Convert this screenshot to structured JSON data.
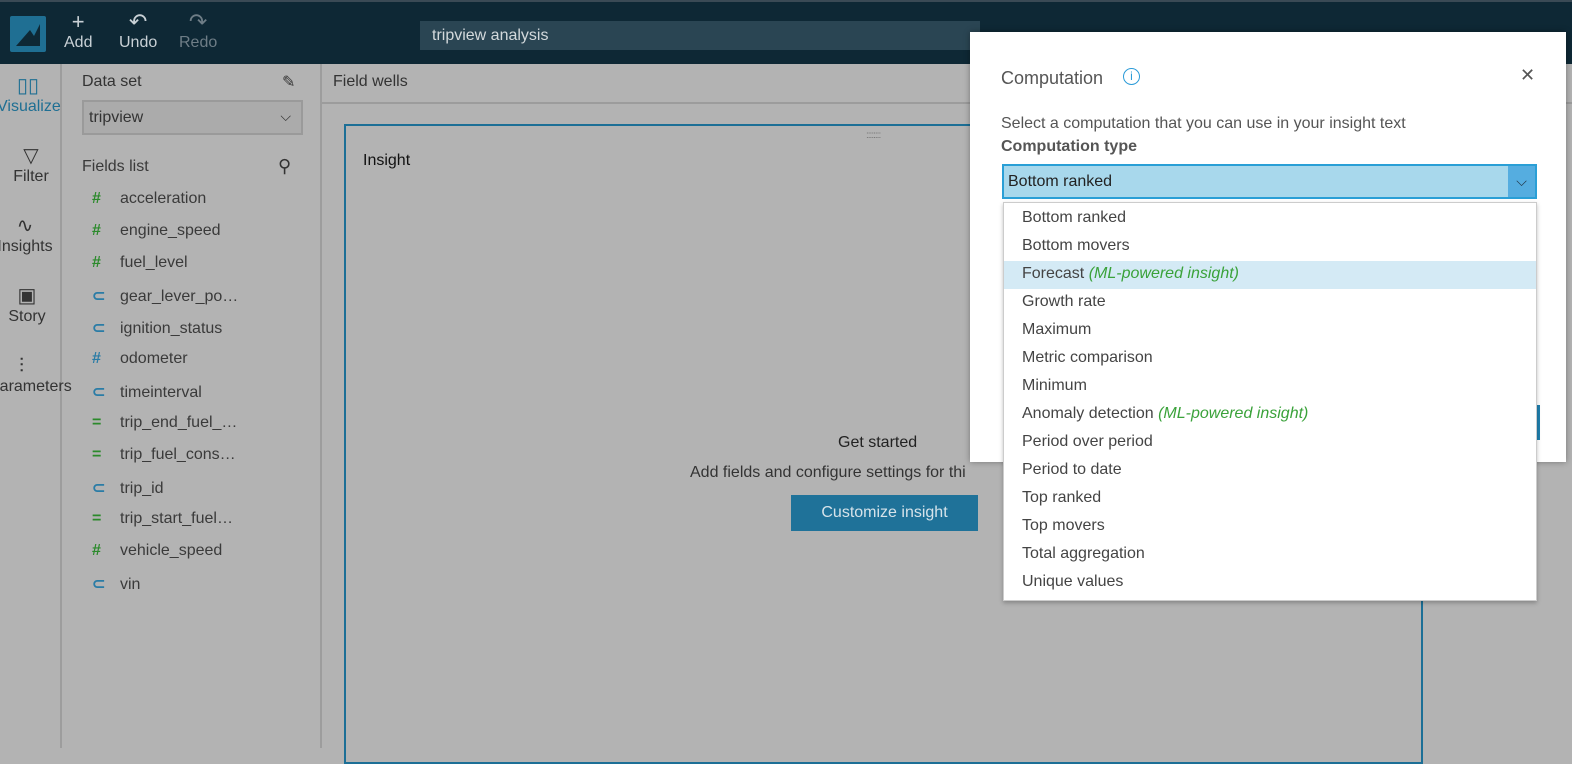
{
  "toolbar": {
    "add": "Add",
    "undo": "Undo",
    "redo": "Redo",
    "analysis_title": "tripview analysis"
  },
  "rail": [
    {
      "label": "Visualize",
      "icon": "bar-chart-icon",
      "active": true
    },
    {
      "label": "Filter",
      "icon": "funnel-icon"
    },
    {
      "label": "Insights",
      "icon": "line-chart-icon"
    },
    {
      "label": "Story",
      "icon": "story-icon"
    },
    {
      "label": "Parameters",
      "icon": "sliders-icon"
    }
  ],
  "dataset": {
    "label": "Data set",
    "value": "tripview",
    "fields_label": "Fields list"
  },
  "fields": [
    {
      "name": "acceleration",
      "type": "measure"
    },
    {
      "name": "engine_speed",
      "type": "measure"
    },
    {
      "name": "fuel_level",
      "type": "measure"
    },
    {
      "name": "gear_lever_po…",
      "type": "dimension"
    },
    {
      "name": "ignition_status",
      "type": "dimension"
    },
    {
      "name": "odometer",
      "type": "dimension-number"
    },
    {
      "name": "timeinterval",
      "type": "dimension"
    },
    {
      "name": "trip_end_fuel_…",
      "type": "calculated"
    },
    {
      "name": "trip_fuel_cons…",
      "type": "calculated"
    },
    {
      "name": "trip_id",
      "type": "dimension"
    },
    {
      "name": "trip_start_fuel…",
      "type": "calculated"
    },
    {
      "name": "vehicle_speed",
      "type": "measure"
    },
    {
      "name": "vin",
      "type": "dimension"
    }
  ],
  "main": {
    "field_wells": "Field wells",
    "visual_title": "Insight",
    "get_started": "Get started",
    "hint": "Add fields and configure settings for thi",
    "customize": "Customize insight"
  },
  "modal": {
    "title": "Computation",
    "description": "Select a computation that you can use in your insight text",
    "type_label": "Computation type",
    "selected": "Bottom ranked",
    "options": [
      {
        "label": "Bottom ranked"
      },
      {
        "label": "Bottom movers"
      },
      {
        "label": "Forecast",
        "tag": "(ML-powered insight)",
        "highlighted": true
      },
      {
        "label": "Growth rate"
      },
      {
        "label": "Maximum"
      },
      {
        "label": "Metric comparison"
      },
      {
        "label": "Minimum"
      },
      {
        "label": "Anomaly detection",
        "tag": "(ML-powered insight)"
      },
      {
        "label": "Period over period"
      },
      {
        "label": "Period to date"
      },
      {
        "label": "Top ranked"
      },
      {
        "label": "Top movers"
      },
      {
        "label": "Total aggregation"
      },
      {
        "label": "Unique values"
      }
    ]
  },
  "colors": {
    "accent": "#1f7299",
    "ml_tag": "#3aa23a",
    "highlight": "#d4eaf5"
  }
}
